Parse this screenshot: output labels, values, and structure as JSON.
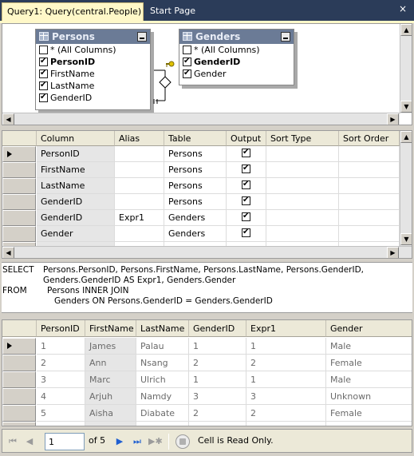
{
  "tabs": {
    "active_label": "Query1: Query(central.People)",
    "inactive_label": "Start Page",
    "close_glyph": "×"
  },
  "diagram": {
    "persons": {
      "title": "Persons",
      "rows": [
        {
          "label": "* (All Columns)",
          "checked": false,
          "bold": false
        },
        {
          "label": "PersonID",
          "checked": true,
          "bold": true
        },
        {
          "label": "FirstName",
          "checked": true,
          "bold": false
        },
        {
          "label": "LastName",
          "checked": true,
          "bold": false
        },
        {
          "label": "GenderID",
          "checked": true,
          "bold": false
        }
      ]
    },
    "genders": {
      "title": "Genders",
      "rows": [
        {
          "label": "* (All Columns)",
          "checked": false,
          "bold": false
        },
        {
          "label": "GenderID",
          "checked": true,
          "bold": true
        },
        {
          "label": "Gender",
          "checked": true,
          "bold": false
        }
      ]
    }
  },
  "criteria": {
    "headers": [
      "Column",
      "Alias",
      "Table",
      "Output",
      "Sort Type",
      "Sort Order"
    ],
    "rows": [
      {
        "column": "PersonID",
        "alias": "",
        "table": "Persons",
        "output": true
      },
      {
        "column": "FirstName",
        "alias": "",
        "table": "Persons",
        "output": true
      },
      {
        "column": "LastName",
        "alias": "",
        "table": "Persons",
        "output": true
      },
      {
        "column": "GenderID",
        "alias": "",
        "table": "Persons",
        "output": true
      },
      {
        "column": "GenderID",
        "alias": "Expr1",
        "table": "Genders",
        "output": true
      },
      {
        "column": "Gender",
        "alias": "",
        "table": "Genders",
        "output": true
      }
    ]
  },
  "sql": {
    "kw_select": "SELECT",
    "line1": "Persons.PersonID, Persons.FirstName, Persons.LastName, Persons.GenderID,",
    "line2": "Genders.GenderID AS Expr1, Genders.Gender",
    "kw_from": "FROM",
    "line3": "Persons INNER JOIN",
    "line4": "Genders ON Persons.GenderID = Genders.GenderID"
  },
  "results": {
    "headers": [
      "PersonID",
      "FirstName",
      "LastName",
      "GenderID",
      "Expr1",
      "Gender"
    ],
    "rows": [
      [
        "1",
        "James",
        "Palau",
        "1",
        "1",
        "Male"
      ],
      [
        "2",
        "Ann",
        "Nsang",
        "2",
        "2",
        "Female"
      ],
      [
        "3",
        "Marc",
        "Ulrich",
        "1",
        "1",
        "Male"
      ],
      [
        "4",
        "Arjuh",
        "Namdy",
        "3",
        "3",
        "Unknown"
      ],
      [
        "5",
        "Aisha",
        "Diabate",
        "2",
        "2",
        "Female"
      ]
    ]
  },
  "navigator": {
    "current_page": "1",
    "of_label": "of 5",
    "status": "Cell is Read Only."
  },
  "colors": {
    "tab_strip": "#2b3c59",
    "active_tab": "#fff8c8",
    "table_title": "#6b7b96",
    "nav_accent": "#1f5fd1"
  }
}
